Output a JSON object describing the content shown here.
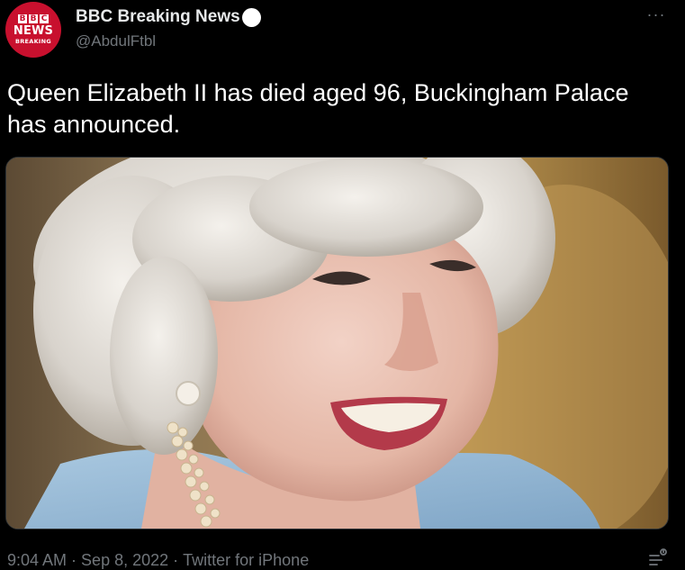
{
  "account": {
    "display_name": "BBC Breaking News",
    "handle": "@AbdulFtbl",
    "avatar": {
      "bbc_letters": [
        "B",
        "B",
        "C"
      ],
      "news_label": "NEWS",
      "breaking_label": "BREAKING",
      "color": "#c8102e"
    }
  },
  "header": {
    "more_label": "···"
  },
  "tweet": {
    "text": "Queen Elizabeth II has died aged 96, Buckingham Palace has announced."
  },
  "meta": {
    "time": "9:04 AM",
    "separator": "·",
    "date": "Sep 8, 2022",
    "source": "Twitter for iPhone"
  },
  "icons": {
    "more": "more-horizontal-icon",
    "analytics": "tweet-analytics-icon",
    "verified": "verified-badge-icon"
  },
  "colors": {
    "background": "#000000",
    "text": "#ffffff",
    "muted": "#71767b"
  }
}
